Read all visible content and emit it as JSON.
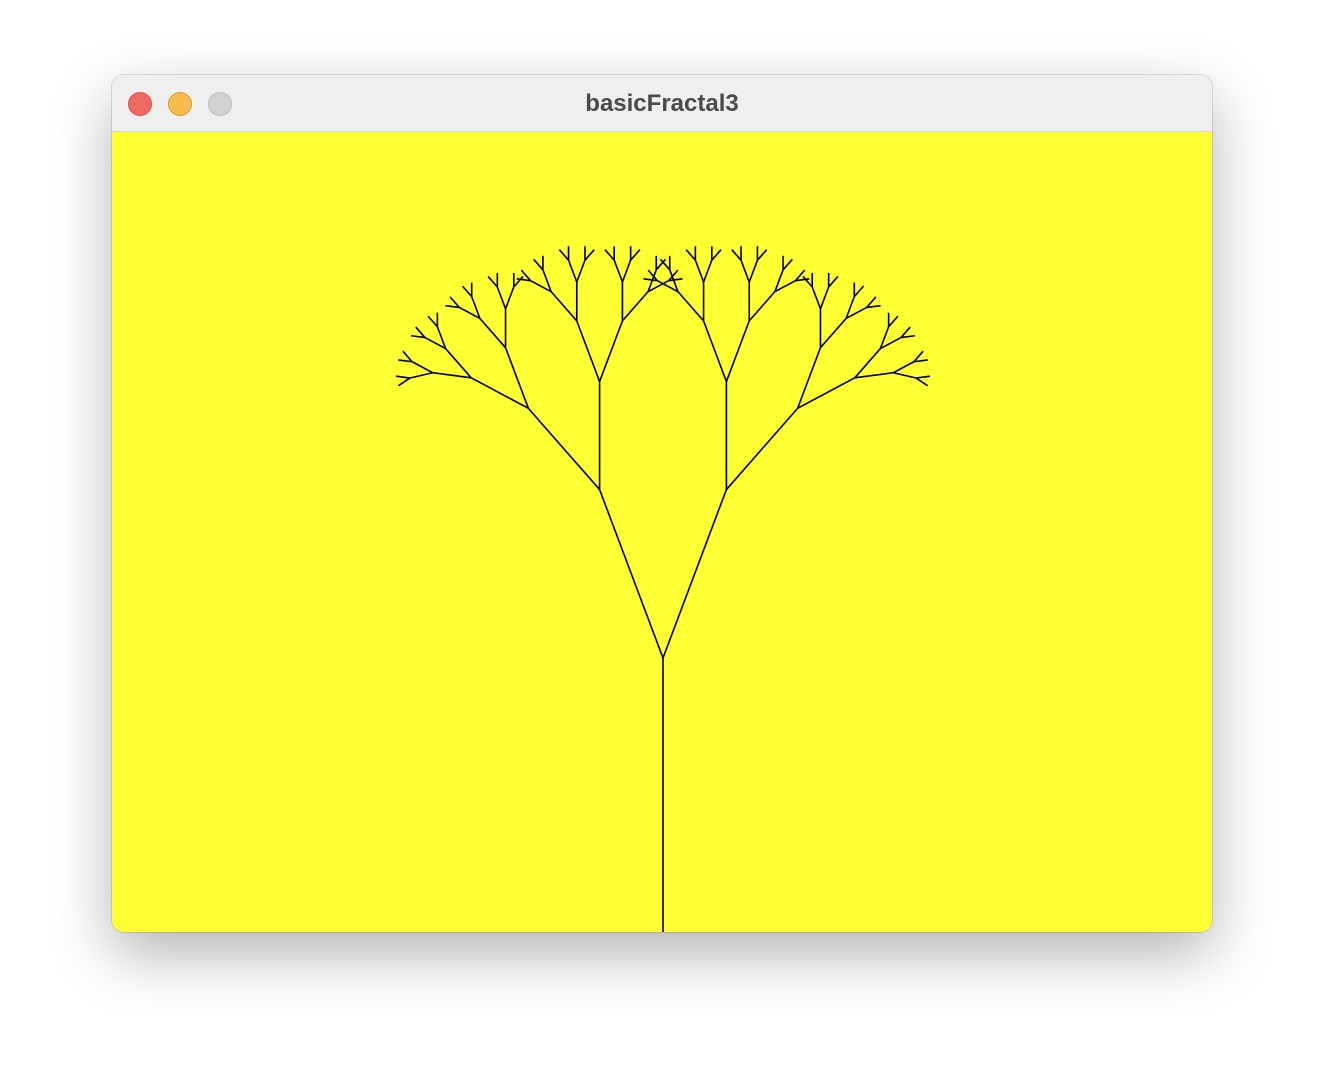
{
  "window": {
    "title": "basicFractal3"
  },
  "traffic_lights": {
    "close_color": "#ee6a5f",
    "minimize_color": "#f5bd4f",
    "zoom_color": "#d3d3d3"
  },
  "canvas": {
    "background_color": "#ffff33",
    "stroke_color": "#000000"
  }
}
